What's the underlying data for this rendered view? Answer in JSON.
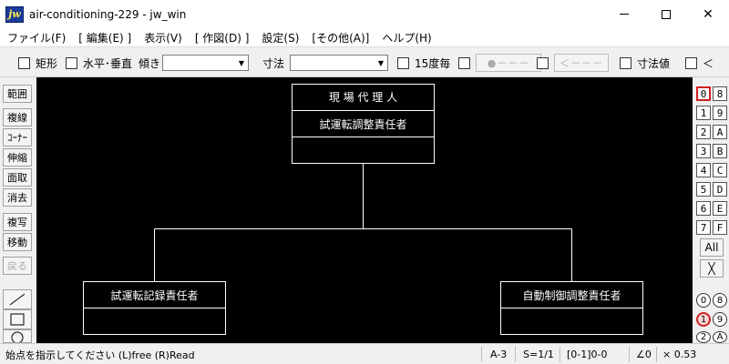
{
  "window": {
    "app_icon": "jw",
    "title": "air-conditioning-229 - jw_win"
  },
  "menu": [
    "ファイル(F)",
    "[ 編集(E) ]",
    "表示(V)",
    "[ 作図(D) ]",
    "設定(S)",
    "[その他(A)]",
    "ヘルプ(H)"
  ],
  "toolbar": {
    "rect_label": "矩形",
    "hv_label": "水平･垂直",
    "tilt_label": "傾き",
    "tilt_value": "",
    "dim_label": "寸法",
    "dim_value": "",
    "deg15_label": "15度毎",
    "btn_dot": "●－－－",
    "btn_arrow": "＜－－－",
    "dimval_label": "寸法値",
    "lt_label": "＜"
  },
  "left_tools": [
    "範囲",
    "複線",
    "ｺｰﾅｰ",
    "伸縮",
    "面取",
    "消去",
    "複写",
    "移動",
    "戻る"
  ],
  "right_tools": {
    "layers_left": [
      "0",
      "1",
      "2",
      "3",
      "4",
      "5",
      "6",
      "7"
    ],
    "layers_right": [
      "8",
      "9",
      "A",
      "B",
      "C",
      "D",
      "E",
      "F"
    ],
    "all_label": "All",
    "groups_left": [
      "0",
      "1",
      "2"
    ],
    "groups_right": [
      "8",
      "9",
      "A"
    ]
  },
  "drawing": {
    "top_box": {
      "title": "現 場 代 理 人",
      "role": "試運転調整責任者"
    },
    "left_box": {
      "title": "試運転記録責任者"
    },
    "right_box": {
      "title": "自動制御調整責任者"
    }
  },
  "status": {
    "message": "始点を指示してください (L)free (R)Read",
    "paper": "A-3",
    "scale": "S=1/1",
    "layer": "[0-1]0-0",
    "angle": "∠0",
    "zoom": "× 0.53"
  },
  "colors": {
    "canvas_bg": "#000000",
    "drawing_line": "#ffffff",
    "active_layer_border": "#d02020"
  }
}
